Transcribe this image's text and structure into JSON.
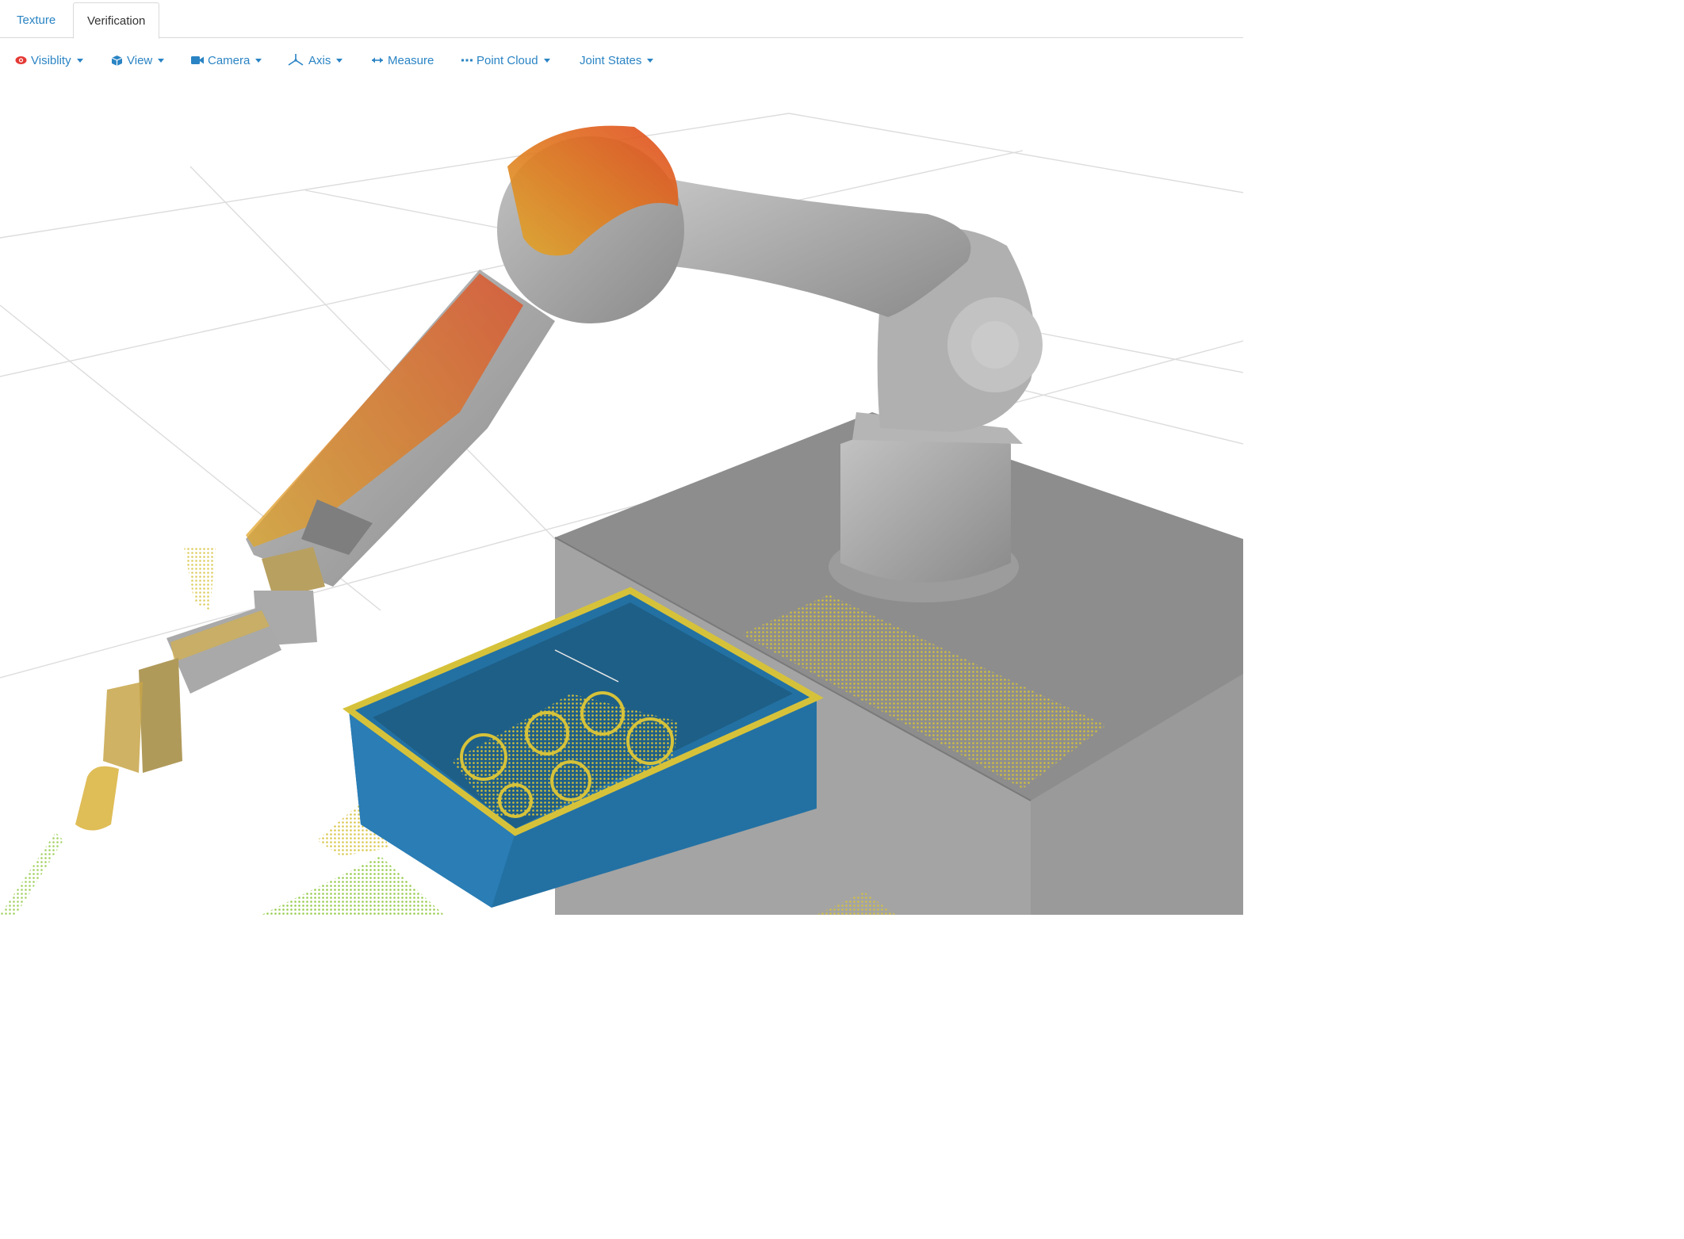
{
  "tabs": [
    {
      "label": "Texture",
      "active": false
    },
    {
      "label": "Verification",
      "active": true
    }
  ],
  "toolbar": {
    "visibility": {
      "label": "Visiblity",
      "icon": "eye-icon",
      "color": "#e53935"
    },
    "view": {
      "label": "View",
      "icon": "cube-icon"
    },
    "camera": {
      "label": "Camera",
      "icon": "video-camera-icon"
    },
    "axis": {
      "label": "Axis",
      "icon": "axis-icon"
    },
    "measure": {
      "label": "Measure",
      "icon": "arrows-horizontal-icon"
    },
    "point_cloud": {
      "label": "Point Cloud",
      "icon": "dots-icon"
    },
    "joint_states": {
      "label": "Joint States"
    }
  },
  "colors": {
    "accent": "#2a84c4",
    "bin": "#2371a3",
    "robot": "#a8a8a8",
    "pedestal": "#8f8f8f",
    "cloud_orange": "#e07a1e",
    "cloud_yellow": "#d6c23a",
    "cloud_green": "#8cc63a"
  }
}
